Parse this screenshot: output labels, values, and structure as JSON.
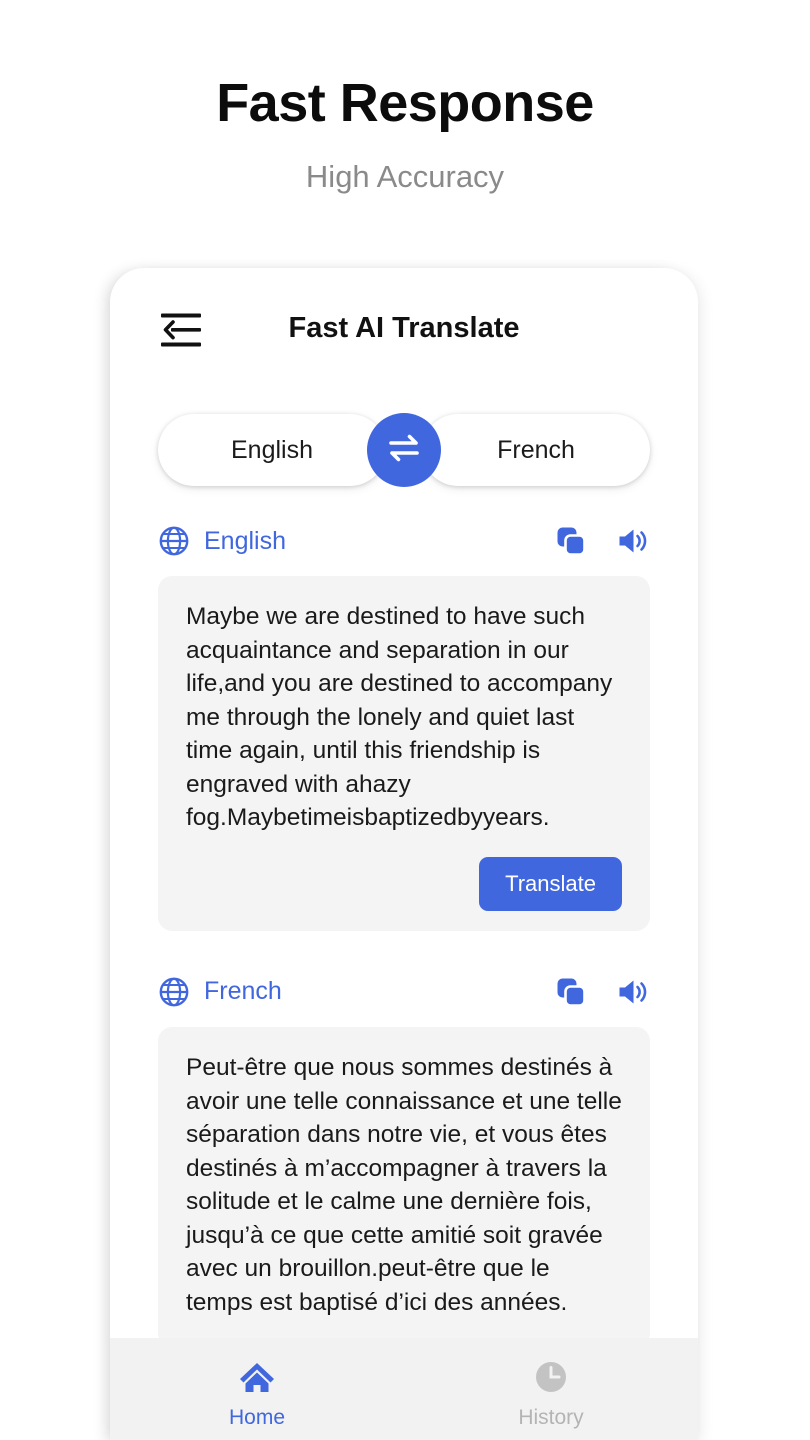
{
  "promo": {
    "title": "Fast Response",
    "subtitle": "High Accuracy"
  },
  "colors": {
    "accent": "#4167df",
    "card_bg": "#f4f4f4",
    "nav_bg": "#f2f2f2",
    "inactive": "#b4b4b4",
    "title": "#0c0c0c",
    "subtitle": "#8a8a8a"
  },
  "appbar": {
    "title": "Fast AI Translate",
    "back_icon": "menu-back-arrow-icon"
  },
  "language_selector": {
    "source": "English",
    "target": "French",
    "swap_icon": "swap-horizontal-icon"
  },
  "source_panel": {
    "globe_icon": "globe-icon",
    "language": "English",
    "copy_icon": "copy-icon",
    "speaker_icon": "speaker-icon",
    "text": "Maybe we are destined to have such acquaintance and separation in our life,and you are destined to accompany me through the lonely and quiet last time again, until this friendship is engraved with ahazy fog.Maybetimeisbaptizedbyyears.",
    "translate_label": "Translate"
  },
  "target_panel": {
    "globe_icon": "globe-icon",
    "language": "French",
    "copy_icon": "copy-icon",
    "speaker_icon": "speaker-icon",
    "text": "Peut-être que nous sommes destinés à avoir une telle connaissance et une telle séparation dans notre vie, et vous êtes destinés à m’accompagner à travers la solitude et le calme une dernière fois, jusqu’à ce que cette amitié soit gravée avec un brouillon.peut-être que le temps est baptisé d’ici des années."
  },
  "bottom_nav": {
    "items": [
      {
        "label": "Home",
        "icon": "home-icon",
        "active": true
      },
      {
        "label": "History",
        "icon": "clock-icon",
        "active": false
      }
    ]
  }
}
